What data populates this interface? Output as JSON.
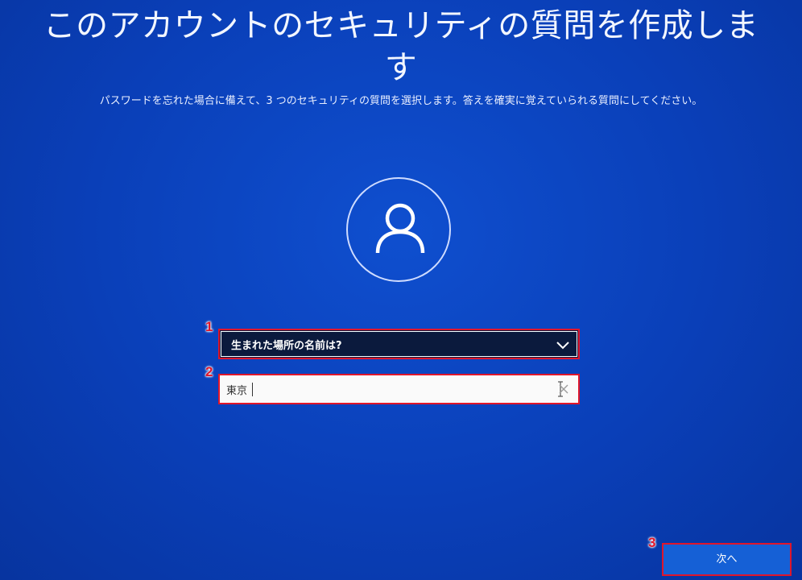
{
  "page": {
    "title_line1": "このアカウントのセキュリティの質問を作成しま",
    "title_line2": "す",
    "subtitle": "パスワードを忘れた場合に備えて、3 つのセキュリティの質問を選択します。答えを確実に覚えていられる質問にしてください。"
  },
  "avatar": {
    "icon": "user-icon"
  },
  "question": {
    "selected": "生まれた場所の名前は?",
    "icon": "chevron-down-icon"
  },
  "answer": {
    "value": "東京",
    "clear_icon": "close-icon"
  },
  "next_button": {
    "label": "次へ"
  },
  "markers": {
    "m1": "1",
    "m2": "2",
    "m3": "3",
    "color": "#e0162b"
  },
  "colors": {
    "background": "#0a3fb8",
    "dropdown_bg": "#0b1a3d",
    "button_bg": "#1560d6"
  }
}
